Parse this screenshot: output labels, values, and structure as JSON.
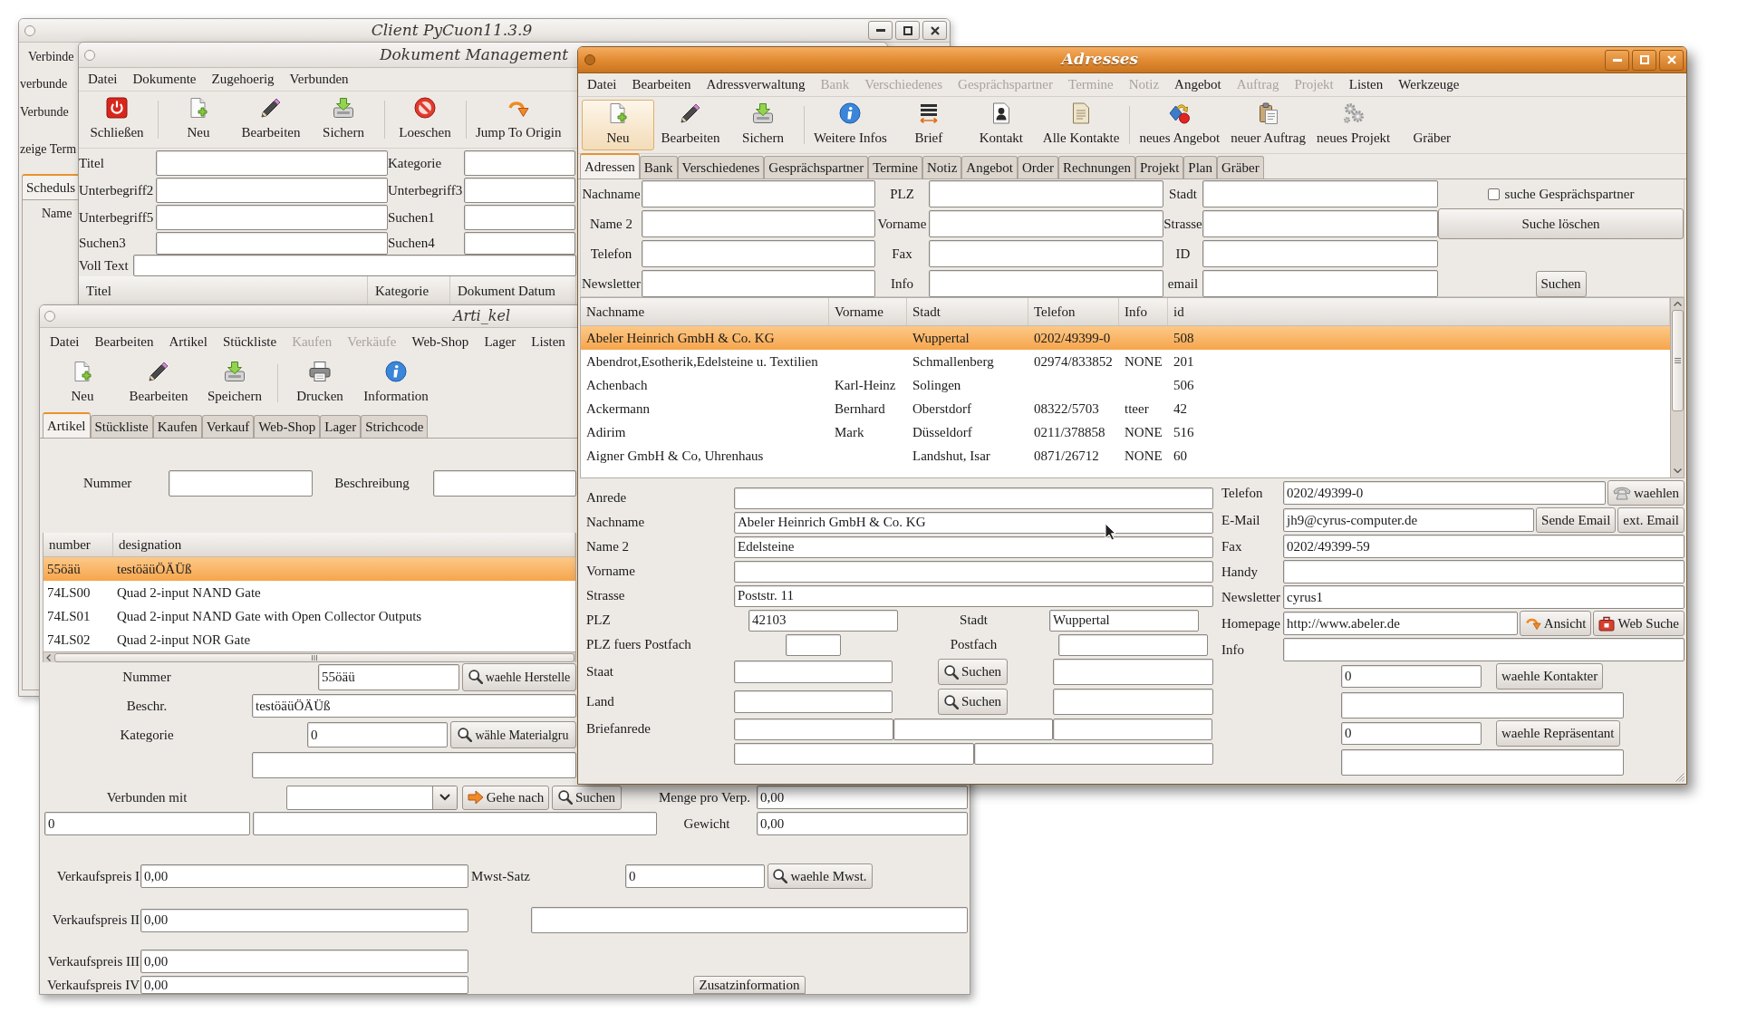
{
  "client_window": {
    "title": "Client PyCuon11.3.9",
    "menu": [
      {
        "label": "Verbinde"
      }
    ],
    "labels": [
      "verbunde",
      "Verbunde",
      "zeige Term"
    ],
    "tabs": [
      {
        "label": "Scheduls",
        "selected": true
      }
    ],
    "table": {
      "columns": [
        "Name"
      ]
    }
  },
  "document_window": {
    "title": "Dokument Management",
    "menu": [
      {
        "label": "Datei"
      },
      {
        "label": "Dokumente"
      },
      {
        "label": "Zugehoerig"
      },
      {
        "label": "Verbunden"
      }
    ],
    "toolbar_groups": [
      {
        "items": [
          {
            "label": "Schließen"
          }
        ]
      },
      {
        "items": [
          {
            "label": "Neu"
          },
          {
            "label": "Bearbeiten"
          },
          {
            "label": "Sichern"
          }
        ]
      },
      {
        "items": [
          {
            "label": "Loeschen"
          }
        ]
      },
      {
        "items": [
          {
            "label": "Jump To Origin"
          }
        ]
      }
    ],
    "search_rows": [
      {
        "fields": [
          {
            "label": "Titel"
          },
          {
            "label": "Kategorie"
          }
        ]
      },
      {
        "fields": [
          {
            "label": "Unterbegriff2"
          },
          {
            "label": "Unterbegriff3"
          }
        ]
      },
      {
        "fields": [
          {
            "label": "Unterbegriff5"
          },
          {
            "label": "Suchen1"
          }
        ]
      },
      {
        "fields": [
          {
            "label": "Suchen3"
          },
          {
            "label": "Suchen4"
          }
        ]
      }
    ],
    "full_text": {
      "label": "Voll Text"
    },
    "table": {
      "columns": [
        "Titel",
        "Kategorie",
        "Dokument Datum"
      ]
    }
  },
  "article_window": {
    "title": "Arti_kel",
    "menu": [
      {
        "label": "Datei",
        "disabled": false
      },
      {
        "label": "Bearbeiten",
        "disabled": false
      },
      {
        "label": "Artikel",
        "disabled": false
      },
      {
        "label": "Stückliste",
        "disabled": false
      },
      {
        "label": "Kaufen",
        "disabled": true
      },
      {
        "label": "Verkäufe",
        "disabled": true
      },
      {
        "label": "Web-Shop",
        "disabled": false
      },
      {
        "label": "Lager",
        "disabled": false
      },
      {
        "label": "Listen",
        "disabled": false
      }
    ],
    "toolbar_groups": [
      {
        "items": [
          {
            "label": "Neu"
          },
          {
            "label": "Bearbeiten"
          },
          {
            "label": "Speichern"
          }
        ]
      },
      {
        "items": [
          {
            "label": "Drucken"
          },
          {
            "label": "Information"
          }
        ]
      }
    ],
    "tabs": [
      {
        "label": "Artikel",
        "selected": true
      },
      {
        "label": "Stückliste",
        "selected": false
      },
      {
        "label": "Kaufen",
        "selected": false
      },
      {
        "label": "Verkauf",
        "selected": false
      },
      {
        "label": "Web-Shop",
        "selected": false
      },
      {
        "label": "Lager",
        "selected": false
      },
      {
        "label": "Strichcode",
        "selected": false
      }
    ],
    "search": [
      {
        "label": "Nummer"
      },
      {
        "label": "Beschreibung"
      }
    ],
    "table": {
      "columns": [
        "number",
        "designation"
      ],
      "rows": [
        {
          "number": "55öäü",
          "designation": "testöäüÖÄÜß",
          "selected": true
        },
        {
          "number": "74LS00",
          "designation": "Quad 2-input NAND Gate",
          "selected": false
        },
        {
          "number": "74LS01",
          "designation": "Quad 2-input NAND Gate with Open Collector Outputs",
          "selected": false
        },
        {
          "number": "74LS02",
          "designation": "Quad 2-input NOR Gate",
          "selected": false
        }
      ]
    },
    "detail": {
      "number": {
        "label": "Nummer",
        "value": "55öäü",
        "button": "waehle Herstelle"
      },
      "description": {
        "label": "Beschr.",
        "value": "testöäüÖÄÜß"
      },
      "category": {
        "label": "Kategorie",
        "value": "0",
        "button": "wähle Materialgru"
      },
      "linked": {
        "label": "Verbunden mit",
        "goto_button": "Gehe nach",
        "search_button": "Suchen"
      },
      "pack_quantity": {
        "label": "Menge pro Verp.",
        "value": "0,00"
      },
      "linked_number": {
        "value": "0"
      },
      "weight": {
        "label": "Gewicht",
        "value": "0,00"
      },
      "prices": [
        {
          "label": "Verkaufspreis I",
          "value": "0,00"
        },
        {
          "label": "Verkaufspreis II",
          "value": "0,00"
        },
        {
          "label": "Verkaufspreis III",
          "value": "0,00"
        },
        {
          "label": "Verkaufspreis IV",
          "value": "0,00"
        }
      ],
      "vat": {
        "label": "Mwst-Satz",
        "value": "0",
        "button": "waehle Mwst."
      },
      "info_button": "Zusatzinformation"
    }
  },
  "address_window": {
    "title": "Adresses",
    "menu": [
      {
        "label": "Datei",
        "disabled": false
      },
      {
        "label": "Bearbeiten",
        "disabled": false
      },
      {
        "label": "Adressverwaltung",
        "disabled": false
      },
      {
        "label": "Bank",
        "disabled": true
      },
      {
        "label": "Verschiedenes",
        "disabled": true
      },
      {
        "label": "Gesprächspartner",
        "disabled": true
      },
      {
        "label": "Termine",
        "disabled": true
      },
      {
        "label": "Notiz",
        "disabled": true
      },
      {
        "label": "Angebot",
        "disabled": false
      },
      {
        "label": "Auftrag",
        "disabled": true
      },
      {
        "label": "Projekt",
        "disabled": true
      },
      {
        "label": "Listen",
        "disabled": false
      },
      {
        "label": "Werkzeuge",
        "disabled": false
      }
    ],
    "toolbar_groups": [
      {
        "items": [
          {
            "label": "Neu",
            "highlighted": true
          },
          {
            "label": "Bearbeiten",
            "highlighted": false
          },
          {
            "label": "Sichern",
            "highlighted": false
          }
        ]
      },
      {
        "items": [
          {
            "label": "Weitere Infos",
            "highlighted": false
          },
          {
            "label": "Brief",
            "highlighted": false
          },
          {
            "label": "Kontakt",
            "highlighted": false
          },
          {
            "label": "Alle Kontakte",
            "highlighted": false
          }
        ]
      },
      {
        "items": [
          {
            "label": "neues Angebot",
            "highlighted": false
          },
          {
            "label": "neuer Auftrag",
            "highlighted": false
          },
          {
            "label": "neues Projekt",
            "highlighted": false
          },
          {
            "label": "Gräber",
            "highlighted": false
          }
        ]
      }
    ],
    "tabs": [
      {
        "label": "Adressen",
        "selected": true
      },
      {
        "label": "Bank",
        "selected": false
      },
      {
        "label": "Verschiedenes",
        "selected": false
      },
      {
        "label": "Gesprächspartner",
        "selected": false
      },
      {
        "label": "Termine",
        "selected": false
      },
      {
        "label": "Notiz",
        "selected": false
      },
      {
        "label": "Angebot",
        "selected": false
      },
      {
        "label": "Order",
        "selected": false
      },
      {
        "label": "Rechnungen",
        "selected": false
      },
      {
        "label": "Projekt",
        "selected": false
      },
      {
        "label": "Plan",
        "selected": false
      },
      {
        "label": "Gräber",
        "selected": false
      }
    ],
    "search": {
      "rows": [
        {
          "fields": [
            {
              "label": "Nachname"
            },
            {
              "label": "PLZ"
            },
            {
              "label": "Stadt"
            }
          ]
        },
        {
          "fields": [
            {
              "label": "Name 2"
            },
            {
              "label": "Vorname"
            },
            {
              "label": "Strasse"
            }
          ]
        },
        {
          "fields": [
            {
              "label": "Telefon"
            },
            {
              "label": "Fax"
            },
            {
              "label": "ID"
            }
          ]
        },
        {
          "fields": [
            {
              "label": "Newsletter"
            },
            {
              "label": "Info"
            },
            {
              "label": "email"
            }
          ]
        }
      ],
      "partner_checkbox": {
        "label": "suche Gesprächspartner",
        "checked": false
      },
      "clear_button": "Suche löschen",
      "search_button": "Suchen"
    },
    "table": {
      "columns": [
        "Nachname",
        "Vorname",
        "Stadt",
        "Telefon",
        "Info",
        "id"
      ],
      "rows": [
        {
          "last_name": "Abeler Heinrich GmbH & Co. KG",
          "city": "Wuppertal",
          "phone": "0202/49399-0",
          "id": "508",
          "selected": true
        },
        {
          "last_name": "Abendrot,Esotherik,Edelsteine u. Textilien",
          "city": "Schmallenberg",
          "phone": "02974/833852",
          "info": "NONE",
          "id": "201",
          "selected": false
        },
        {
          "last_name": "Achenbach",
          "first_name": "Karl-Heinz",
          "city": "Solingen",
          "id": "506",
          "selected": false
        },
        {
          "last_name": "Ackermann",
          "first_name": "Bernhard",
          "city": "Oberstdorf",
          "phone": "08322/5703",
          "info": "tteer",
          "id": "42",
          "selected": false
        },
        {
          "last_name": "Adirim",
          "first_name": "Mark",
          "city": "Düsseldorf",
          "phone": "0211/378858",
          "info": "NONE",
          "id": "516",
          "selected": false
        },
        {
          "last_name": "Aigner GmbH & Co, Uhrenhaus",
          "city": "Landshut, Isar",
          "phone": "0871/26712",
          "info": "NONE",
          "id": "60",
          "selected": false
        }
      ]
    },
    "detail": {
      "left": [
        {
          "kind": "wide",
          "label": "Anrede"
        },
        {
          "kind": "wide",
          "label": "Nachname",
          "value": "Abeler Heinrich GmbH & Co. KG"
        },
        {
          "kind": "wide",
          "label": "Name 2",
          "value": "Edelsteine"
        },
        {
          "kind": "wide",
          "label": "Vorname"
        },
        {
          "kind": "wide",
          "label": "Strasse",
          "value": "Poststr. 11"
        },
        {
          "kind": "city",
          "label": "PLZ",
          "value": "42103",
          "second_label": "Stadt",
          "second_value": "Wuppertal"
        },
        {
          "kind": "postbox",
          "label": "PLZ fuers Postfach",
          "second_label": "Postfach"
        },
        {
          "kind": "lookup",
          "label": "Staat",
          "button": "Suchen"
        },
        {
          "kind": "lookup",
          "label": "Land",
          "button": "Suchen"
        },
        {
          "kind": "triple",
          "label": "Briefanrede"
        },
        {
          "kind": "double"
        }
      ],
      "right": [
        {
          "kind": "field",
          "label": "Telefon",
          "value": "0202/49399-0",
          "buttons": [
            {
              "kind": "dial",
              "label": "waehlen"
            }
          ]
        },
        {
          "kind": "field",
          "label": "E-Mail",
          "value": "jh9@cyrus-computer.de",
          "buttons": [
            {
              "kind": "send",
              "label": "Sende Email"
            },
            {
              "kind": "external",
              "label": "ext. Email"
            }
          ]
        },
        {
          "kind": "field",
          "label": "Fax",
          "value": "0202/49399-59"
        },
        {
          "kind": "field",
          "label": "Handy"
        },
        {
          "kind": "field",
          "label": "Newsletter",
          "value": "cyrus1"
        },
        {
          "kind": "field",
          "label": "Homepage",
          "value": "http://www.abeler.de",
          "buttons": [
            {
              "kind": "view",
              "label": "Ansicht"
            },
            {
              "kind": "web",
              "label": "Web Suche"
            }
          ]
        },
        {
          "kind": "field",
          "label": "Info"
        },
        {
          "kind": "picker",
          "value": "0",
          "button": "waehle Kontakter"
        },
        {
          "kind": "blank"
        },
        {
          "kind": "picker",
          "value": "0",
          "button": "waehle Repräsentant"
        },
        {
          "kind": "blank"
        }
      ]
    }
  }
}
